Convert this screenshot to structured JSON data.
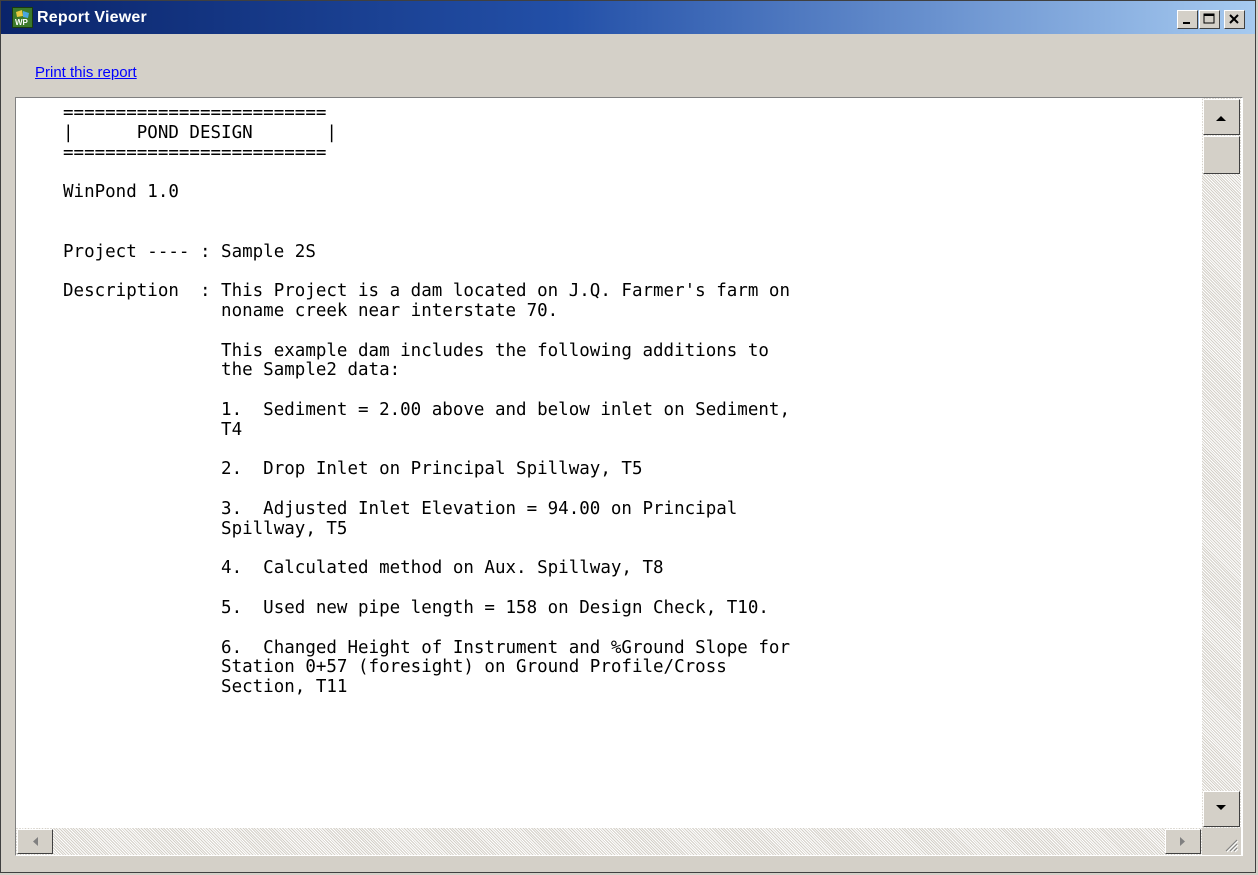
{
  "window": {
    "title": "Report Viewer",
    "icon": "winpond-app-icon",
    "controls": [
      "minimize-icon",
      "maximize-icon",
      "close-icon"
    ]
  },
  "toolbar": {
    "print_link": "Print this report"
  },
  "report": {
    "lines": [
      "=========================",
      "|      POND DESIGN       |",
      "=========================",
      "",
      "WinPond 1.0",
      "",
      "",
      "Project ---- : Sample 2S",
      "",
      "Description  : This Project is a dam located on J.Q. Farmer's farm on",
      "               noname creek near interstate 70.",
      "",
      "               This example dam includes the following additions to",
      "               the Sample2 data:",
      "",
      "               1.  Sediment = 2.00 above and below inlet on Sediment,",
      "               T4",
      "",
      "               2.  Drop Inlet on Principal Spillway, T5",
      "",
      "               3.  Adjusted Inlet Elevation = 94.00 on Principal",
      "               Spillway, T5",
      "",
      "               4.  Calculated method on Aux. Spillway, T8",
      "",
      "               5.  Used new pipe length = 158 on Design Check, T10.",
      "",
      "               6.  Changed Height of Instrument and %Ground Slope for",
      "               Station 0+57 (foresight) on Ground Profile/Cross",
      "               Section, T11"
    ]
  },
  "scrollbars": {
    "vertical": {
      "icons": [
        "scroll-up-icon",
        "scroll-down-icon"
      ],
      "position": 0.0
    },
    "horizontal": {
      "icons": [
        "scroll-left-icon",
        "scroll-right-icon"
      ]
    }
  },
  "colors": {
    "title_gradient_start": "#0a246a",
    "title_gradient_end": "#a6caf0",
    "link": "#0000ff",
    "chrome": "#d4d0c8"
  }
}
